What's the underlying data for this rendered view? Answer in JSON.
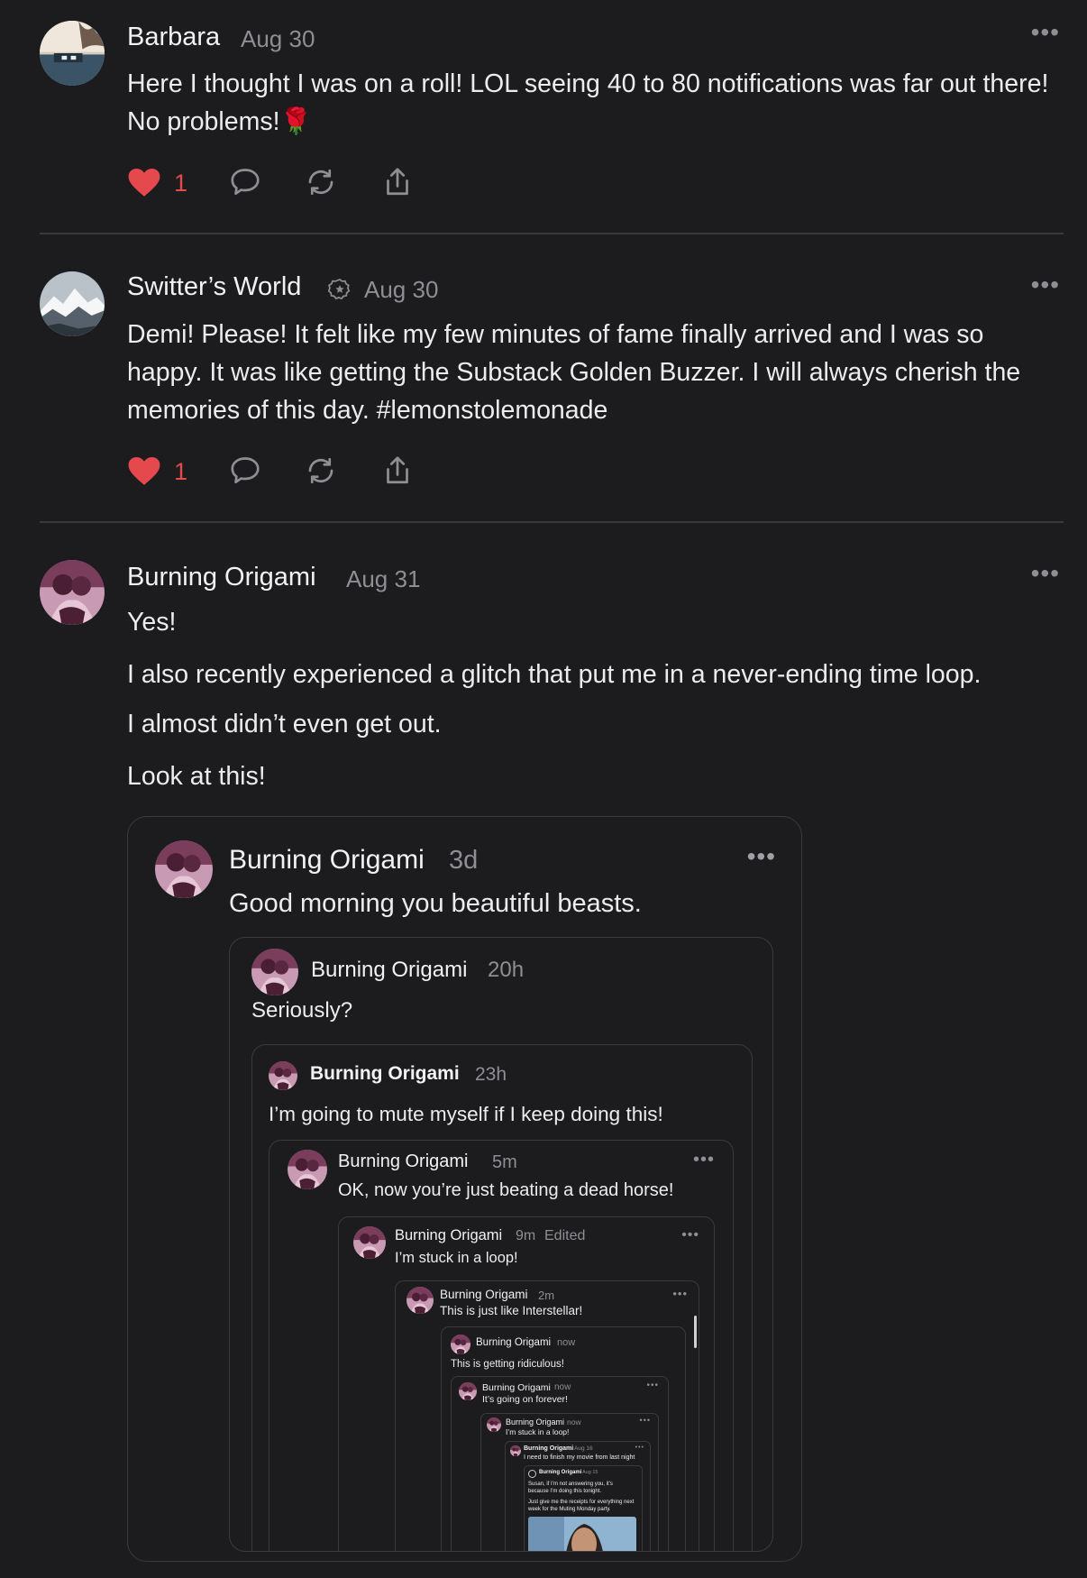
{
  "posts": [
    {
      "author": "Barbara",
      "date": "Aug 30",
      "text": "Here I thought I was on a roll! LOL seeing 40 to 80 notifications was far out there! No problems!🌹",
      "likes": "1",
      "avatar_icon": "lake-tree-photo"
    },
    {
      "author": "Switter’s World",
      "date": "Aug 30",
      "text": "Demi! Please! It felt like my few minutes of fame finally arrived and I was so happy. It was like getting the Substack Golden Buzzer. I will always cherish the memories of this day. #lemonstolemonade",
      "likes": "1",
      "avatar_icon": "snowy-mountain-photo",
      "badge_icon": "verified-icon"
    },
    {
      "author": "Burning Origami",
      "date": "Aug 31",
      "paragraphs": [
        "Yes!",
        "I also recently experienced a glitch that put me in a never-ending time loop.",
        "I almost didn’t even get out.",
        "Look at this!"
      ],
      "avatar_icon": "couple-photo"
    }
  ],
  "embed": {
    "author": "Burning Origami",
    "time": "3d",
    "text": "Good morning you beautiful beasts.",
    "nested": [
      {
        "author": "Burning Origami",
        "time": "20h",
        "text": "Seriously?"
      },
      {
        "author": "Burning Origami",
        "time": "23h",
        "text": "I’m going to mute myself if I keep doing this!"
      },
      {
        "author": "Burning Origami",
        "time": "5m",
        "text": "OK, now you’re just beating a dead horse!"
      },
      {
        "author": "Burning Origami",
        "time": "9m",
        "edited": "Edited",
        "text": "I’m stuck in a loop!"
      },
      {
        "author": "Burning Origami",
        "time": "2m",
        "text": "This is just like Interstellar!"
      },
      {
        "author": "Burning Origami",
        "time": "now",
        "text": "This is getting ridiculous!"
      },
      {
        "author": "Burning Origami",
        "time": "now",
        "text": "It’s going on forever!"
      },
      {
        "author": "Burning Origami",
        "time": "now",
        "text": "I’m stuck in a loop!"
      },
      {
        "author": "Burning Origami",
        "time": "Aug 16",
        "text": "I need to finish my movie from last night"
      },
      {
        "author": "Burning Origami",
        "time": "Aug 15",
        "text": "Susan, if I’m not answering you, it’s because I’m doing this tonight.",
        "text2": "Just give me the receipts for everything next week for the Muting Monday party."
      }
    ]
  },
  "colors": {
    "background": "#1c1c1e",
    "like": "#e5484d",
    "muted": "#8e8e93",
    "divider": "#3a3a3c"
  },
  "icons": {
    "like": "heart-icon",
    "comment": "comment-icon",
    "restack": "restack-icon",
    "share": "share-icon",
    "more": "more-icon"
  }
}
